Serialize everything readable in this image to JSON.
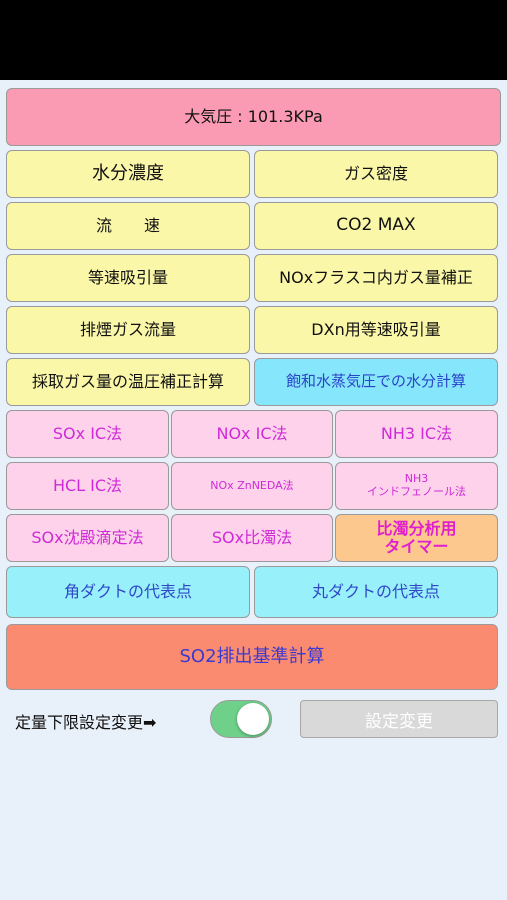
{
  "header": {
    "pressure_label": "大気圧 : 101.3KPa"
  },
  "buttons": {
    "moisture": "水分濃度",
    "gas_density": "ガス密度",
    "flow_speed": "流　　速",
    "co2_max": "CO2 MAX",
    "isokinetic": "等速吸引量",
    "nox_flask": "NOxフラスコ内ガス量補正",
    "exhaust_flow": "排煙ガス流量",
    "dxn_isokinetic": "DXn用等速吸引量",
    "temp_press_correction": "採取ガス量の温圧補正計算",
    "sat_vapor_moisture": "飽和水蒸気圧での水分計算",
    "sox_ic": "SOx IC法",
    "nox_ic": "NOx IC法",
    "nh3_ic": "NH3 IC法",
    "hcl_ic": "HCL IC法",
    "nox_znneda": "NOx ZnNEDA法",
    "nh3_indophenol": "NH3\nインドフェノール法",
    "sox_precip": "SOx沈殿滴定法",
    "sox_turbid": "SOx比濁法",
    "turbid_timer": "比濁分析用\nタイマー",
    "square_duct": "角ダクトの代表点",
    "round_duct": "丸ダクトの代表点",
    "so2_emission": "SO2排出基準計算"
  },
  "footer": {
    "limit_label": "定量下限設定変更➡",
    "toggle_state": "on",
    "settings_button": "設定変更"
  },
  "colors": {
    "header": "#fb9bb3",
    "yellow": "#fbf7a8",
    "cyan": "#86e6fb",
    "light_pink": "#fdd2ea",
    "orange": "#fcc88e",
    "salmon": "#fb8b70",
    "toggle_on": "#6fd08a"
  }
}
